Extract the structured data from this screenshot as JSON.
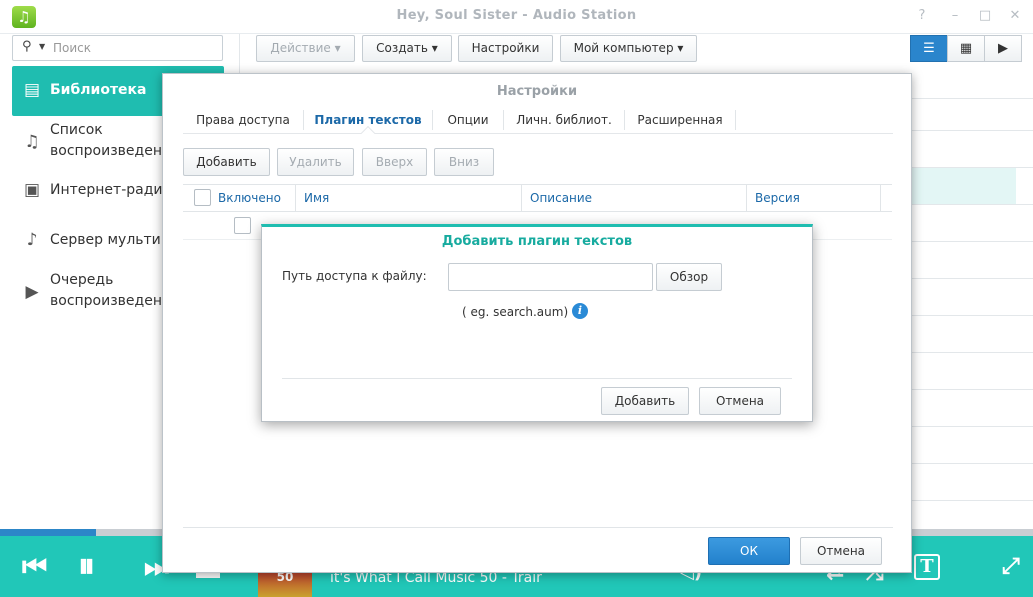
{
  "window": {
    "title": "Hey, Soul Sister - Audio Station",
    "controls": [
      "?",
      "–",
      "□",
      "✕"
    ]
  },
  "search": {
    "placeholder": "Поиск"
  },
  "sidebar": {
    "items": [
      {
        "label": "Библиотека",
        "icon": "library-icon",
        "active": true
      },
      {
        "label": "Список воспроизведения",
        "icon": "playlist-icon",
        "active": false
      },
      {
        "label": "Интернет-радио",
        "icon": "radio-icon",
        "active": false
      },
      {
        "label": "Сервер мультимедиа",
        "icon": "media-server-icon",
        "active": false
      },
      {
        "label": "Очередь воспроизведения",
        "icon": "play-queue-icon",
        "active": false
      }
    ]
  },
  "toolbar": {
    "action": "Действие",
    "create": "Создать",
    "settings": "Настройки",
    "my_computer": "Мой компьютер"
  },
  "player": {
    "track": "it's What I Call Music 50 - Trair",
    "album_badge": "50",
    "progress": 0.093
  },
  "settings_dialog": {
    "title": "Настройки",
    "tabs": [
      "Права доступа",
      "Плагин текстов",
      "Опции",
      "Личн. библиот.",
      "Расширенная"
    ],
    "active_tab": 1,
    "buttons": {
      "add": "Добавить",
      "delete": "Удалить",
      "up": "Вверх",
      "down": "Вниз"
    },
    "columns": {
      "enabled": "Включено",
      "name": "Имя",
      "description": "Описание",
      "version": "Версия"
    },
    "ok": "ОК",
    "cancel": "Отмена"
  },
  "add_plugin_dialog": {
    "title": "Добавить плагин текстов",
    "path_label": "Путь доступа к файлу:",
    "path_value": "",
    "browse": "Обзор",
    "hint": "( eg. search.aum)",
    "add": "Добавить",
    "cancel": "Отмена"
  },
  "colors": {
    "accent": "#21c7b8",
    "primary_button": "#2381cc",
    "link": "#1c69a8"
  }
}
